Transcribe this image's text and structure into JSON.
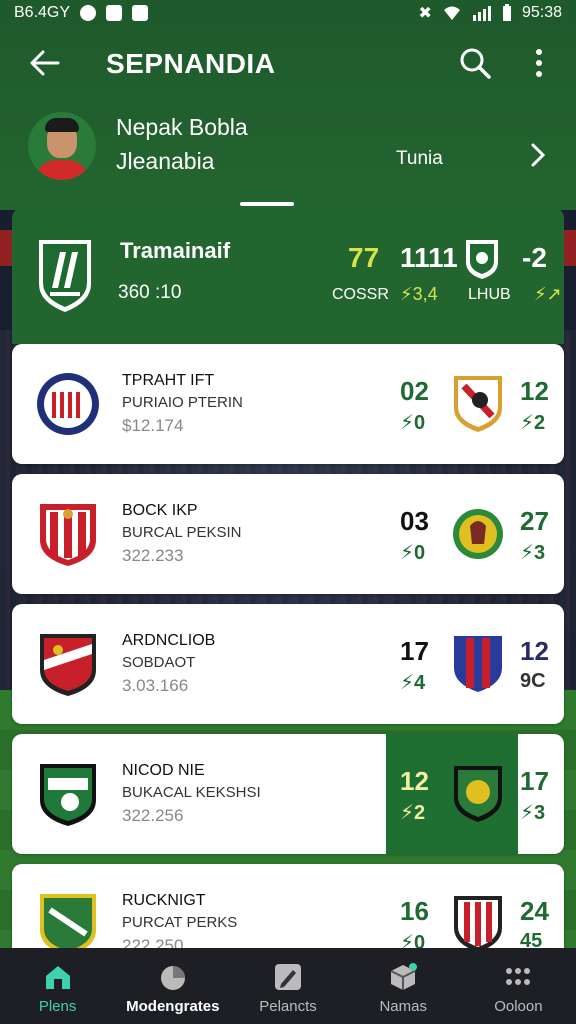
{
  "status_bar": {
    "left_text": "B6.4GY",
    "time": "95:38"
  },
  "app_bar": {
    "title": "SEPNANDIA"
  },
  "profile": {
    "name": "Nepak Bobla",
    "subtitle": "Jleanabia",
    "right_label": "Tunia"
  },
  "feature": {
    "title": "Tramainaif",
    "subtitle": "360 :10",
    "value_1": "77",
    "value_2": "1111",
    "value_3": "-2",
    "label_1": "COSSR",
    "label_2": "⚡3,4",
    "label_3": "LHUB",
    "label_4": "⚡↗"
  },
  "matches": [
    {
      "line1": "TPRAHT IFT",
      "line2": "PURIAIO PTERIN",
      "line3": "$12.174",
      "score_left": "02",
      "delta_left": "⚡0",
      "score_right": "12",
      "delta_right": "⚡2"
    },
    {
      "line1": "BOCK IKP",
      "line2": "BURCAL PEKSIN",
      "line3": "322.233",
      "score_left": "03",
      "delta_left": "⚡0",
      "score_right": "27",
      "delta_right": "⚡3"
    },
    {
      "line1": "ARDNCLIOB",
      "line2": "SOBDAOT",
      "line3": "3.03.166",
      "score_left": "17",
      "delta_left": "⚡4",
      "score_right": "12",
      "delta_right": "9C"
    },
    {
      "line1": "NICOD NIE",
      "line2": "BUKACAL KEKSHSI",
      "line3": "322.256",
      "score_left": "12",
      "delta_left": "⚡2",
      "score_right": "17",
      "delta_right": "⚡3"
    },
    {
      "line1": "RUCKNIGT",
      "line2": "PURCAT PERKS",
      "line3": "222.250",
      "score_left": "16",
      "delta_left": "⚡0",
      "score_right": "24",
      "delta_right": "45"
    }
  ],
  "bottom_nav": [
    {
      "label": "Plens",
      "icon": "home-icon"
    },
    {
      "label": "Modengrates",
      "icon": "chart-icon"
    },
    {
      "label": "Pelancts",
      "icon": "pen-icon"
    },
    {
      "label": "Namas",
      "icon": "cube-icon"
    },
    {
      "label": "Ooloon",
      "icon": "grid-icon"
    }
  ],
  "colors": {
    "header_green": "#1f5b2c",
    "accent_green": "#1f6a32",
    "accent_yellow": "#d6e24a",
    "nav_active": "#3fd0b0"
  }
}
